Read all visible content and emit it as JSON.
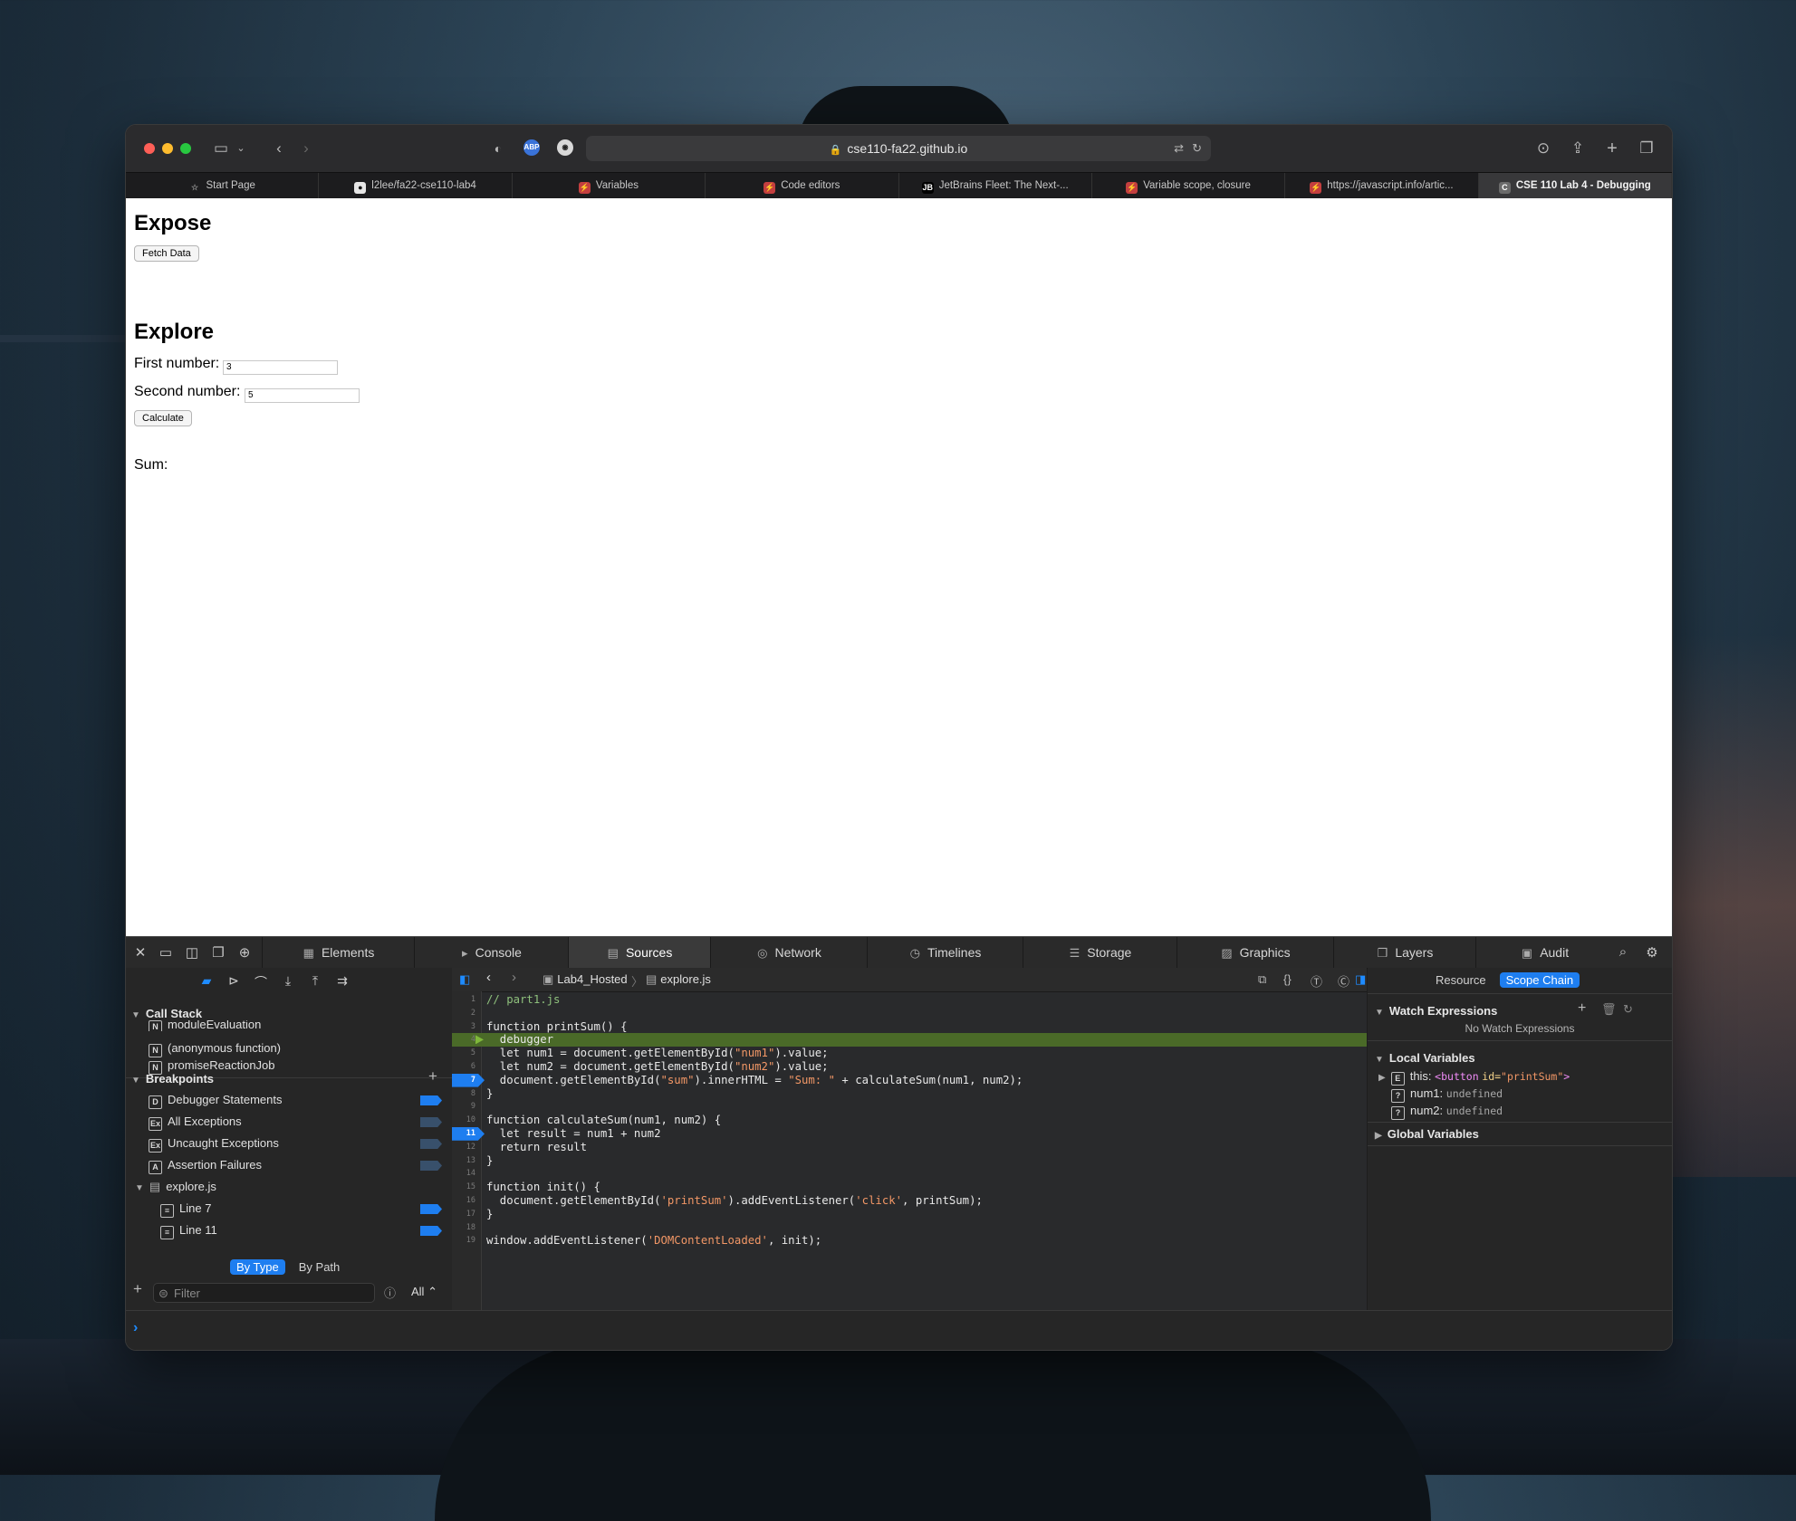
{
  "browser": {
    "url": "cse110-fa22.github.io",
    "tabs": [
      {
        "label": "Start Page",
        "icon": "star-icon",
        "color": "#8a8a8a"
      },
      {
        "label": "l2lee/fa22-cse110-lab4",
        "icon": "github-icon",
        "color": "#e6e6e6"
      },
      {
        "label": "Variables",
        "icon": "javascript-info-icon",
        "color": "#c43f3f"
      },
      {
        "label": "Code editors",
        "icon": "javascript-info-icon",
        "color": "#c43f3f"
      },
      {
        "label": "JetBrains Fleet: The Next-...",
        "icon": "jetbrains-icon",
        "color": "#000000"
      },
      {
        "label": "Variable scope, closure",
        "icon": "javascript-info-icon",
        "color": "#c43f3f"
      },
      {
        "label": "https://javascript.info/artic...",
        "icon": "javascript-info-icon",
        "color": "#c43f3f"
      },
      {
        "label": "CSE 110 Lab 4 - Debugging",
        "icon": "c-icon",
        "color": "#6b6b6b",
        "active": true
      }
    ]
  },
  "page": {
    "expose_heading": "Expose",
    "fetch_button": "Fetch Data",
    "explore_heading": "Explore",
    "first_label": "First number:",
    "first_value": "3",
    "second_label": "Second number:",
    "second_value": "5",
    "calculate_button": "Calculate",
    "sum_label": "Sum:"
  },
  "devtools": {
    "tabs": [
      "Elements",
      "Console",
      "Sources",
      "Network",
      "Timelines",
      "Storage",
      "Graphics",
      "Layers",
      "Audit"
    ],
    "active_tab": "Sources",
    "call_stack": {
      "title": "Call Stack",
      "items": [
        {
          "badge": "N",
          "label": "moduleEvaluation"
        },
        {
          "badge": "N",
          "label": "(anonymous function)"
        },
        {
          "badge": "N",
          "label": "promiseReactionJob"
        }
      ]
    },
    "breakpoints": {
      "title": "Breakpoints",
      "items": [
        {
          "badge": "D",
          "label": "Debugger Statements"
        },
        {
          "badge": "Ex",
          "label": "All Exceptions"
        },
        {
          "badge": "Ex",
          "label": "Uncaught Exceptions"
        },
        {
          "badge": "A",
          "label": "Assertion Failures"
        }
      ],
      "file": "explore.js",
      "lines": [
        "Line 7",
        "Line 11"
      ]
    },
    "segment": {
      "by_type": "By Type",
      "by_path": "By Path"
    },
    "filter_placeholder": "Filter",
    "filter_scope": "All",
    "breadcrumb": {
      "folder": "Lab4_Hosted",
      "file": "explore.js"
    },
    "code_lines": [
      [
        {
          "t": "// part1.js",
          "c": "cm"
        }
      ],
      [],
      [
        {
          "t": "function printSum() {",
          "c": "kw"
        }
      ],
      [
        {
          "t": "  debugger",
          "c": "kw"
        }
      ],
      [
        {
          "t": "  let num1 = document.getElementById(",
          "c": "kw"
        },
        {
          "t": "\"num1\"",
          "c": "str"
        },
        {
          "t": ").value;",
          "c": "kw"
        }
      ],
      [
        {
          "t": "  let num2 = document.getElementById(",
          "c": "kw"
        },
        {
          "t": "\"num2\"",
          "c": "str"
        },
        {
          "t": ").value;",
          "c": "kw"
        }
      ],
      [
        {
          "t": "  document.getElementById(",
          "c": "kw"
        },
        {
          "t": "\"sum\"",
          "c": "str"
        },
        {
          "t": ").innerHTML = ",
          "c": "kw"
        },
        {
          "t": "\"Sum: \"",
          "c": "str"
        },
        {
          "t": " + calculateSum(num1, num2);",
          "c": "kw"
        }
      ],
      [
        {
          "t": "}",
          "c": "kw"
        }
      ],
      [],
      [
        {
          "t": "function calculateSum(num1, num2) {",
          "c": "kw"
        }
      ],
      [
        {
          "t": "  let result = num1 + num2",
          "c": "kw"
        }
      ],
      [
        {
          "t": "  return result",
          "c": "kw"
        }
      ],
      [
        {
          "t": "}",
          "c": "kw"
        }
      ],
      [],
      [
        {
          "t": "function init() {",
          "c": "kw"
        }
      ],
      [
        {
          "t": "  document.getElementById(",
          "c": "kw"
        },
        {
          "t": "'printSum'",
          "c": "str"
        },
        {
          "t": ").addEventListener(",
          "c": "kw"
        },
        {
          "t": "'click'",
          "c": "str"
        },
        {
          "t": ", printSum);",
          "c": "kw"
        }
      ],
      [
        {
          "t": "}",
          "c": "kw"
        }
      ],
      [],
      [
        {
          "t": "window.addEventListener(",
          "c": "kw"
        },
        {
          "t": "'DOMContentLoaded'",
          "c": "str"
        },
        {
          "t": ", init);",
          "c": "kw"
        }
      ]
    ],
    "current_line": 4,
    "breakpoint_lines": [
      7,
      11
    ],
    "right": {
      "resource_tab": "Resource",
      "scope_tab": "Scope Chain",
      "watch_title": "Watch Expressions",
      "watch_empty": "No Watch Expressions",
      "local_title": "Local Variables",
      "this_label": "this:",
      "this_value_tag": "<button",
      "this_value_attr": "id=",
      "this_value_str": "\"printSum\"",
      "this_value_end": ">",
      "num1_label": "num1:",
      "num1_value": "undefined",
      "num2_label": "num2:",
      "num2_value": "undefined",
      "global_title": "Global Variables"
    }
  }
}
